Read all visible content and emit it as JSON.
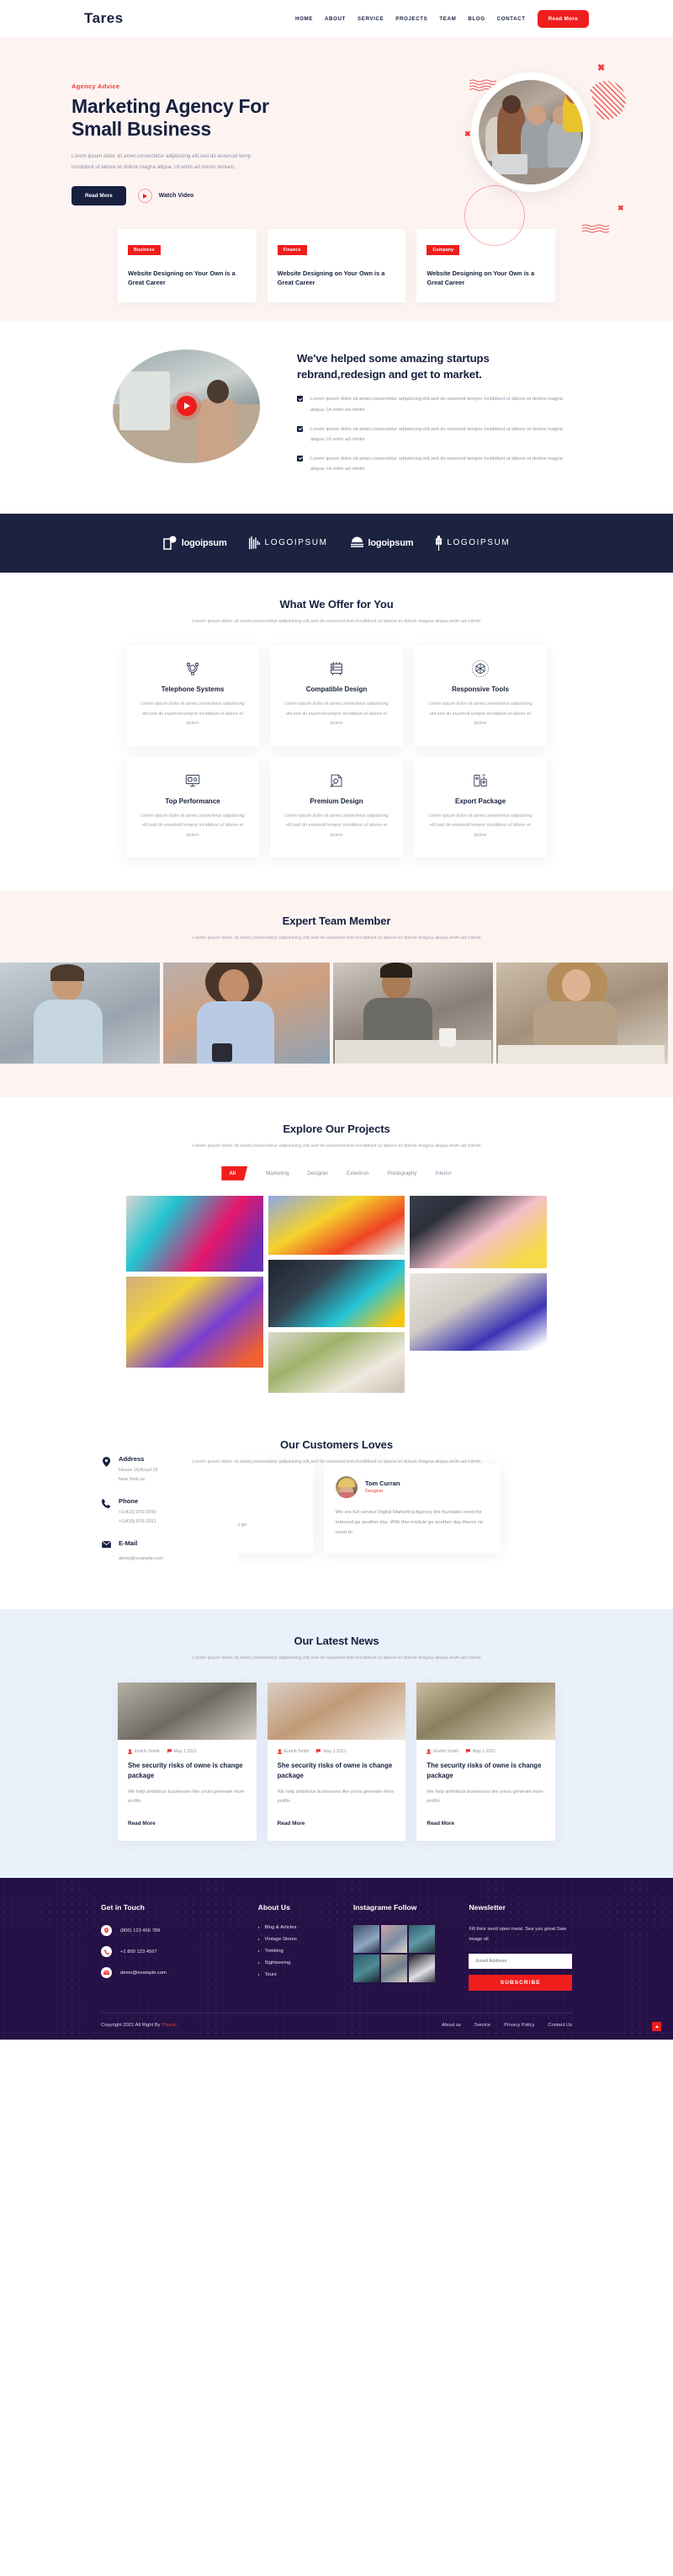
{
  "header": {
    "logo": "Tares",
    "nav": [
      {
        "label": "HOME"
      },
      {
        "label": "ABOUT"
      },
      {
        "label": "SERVICE"
      },
      {
        "label": "PROJECTS"
      },
      {
        "label": "TEAM"
      },
      {
        "label": "BLOG"
      },
      {
        "label": "CONTACT"
      }
    ],
    "cta": "Read More"
  },
  "hero": {
    "eyebrow": "Agency Advice",
    "title_line1": "Marketing Agency For",
    "title_line2": "Small Business",
    "paragraph": "Lorem ipsum dolor sit amet,consectetur adipisicing elit,sed do eiusmod temp incididunt ut labore et dolore magna aliqua. Ut enim ad minim veniam,",
    "primary_button": "Read More",
    "watch_label": "Watch Video",
    "accent_color": "#f01d1d",
    "dark_color": "#17203f",
    "bg_color": "#fdf4f2"
  },
  "top_cards": [
    {
      "tag": "Business",
      "title": "Website Designing on Your Own is a Great Career"
    },
    {
      "tag": "Finance",
      "title": "Website Designing on Your Own is a Great Career"
    },
    {
      "tag": "Company",
      "title": "Website Designing on Your Own is a Great Career"
    }
  ],
  "about": {
    "heading": "We've helped some amazing startups rebrand,redesign and get to market.",
    "checklist": [
      "Lorem ipsum dolor sit amet,consectetur adipisicing elit,sed do eiusmod tempor incididunt ut labore et dolore magna aliqua. Ut enim ad minim",
      "Lorem ipsum dolor sit amet,consectetur adipisicing elit,sed do eiusmod tempor incididunt ut labore et dolore magna aliqua. Ut enim ad minim",
      "Lorem ipsum dolor sit amet,consectetur adipisicing elit,sed do eiusmod tempor incididunt ut labore et dolore magna aliqua. Ut enim ad minim"
    ]
  },
  "logos": [
    {
      "name": "logoipsum",
      "style": "bold"
    },
    {
      "name": "LOGOIPSUM",
      "style": "spaced"
    },
    {
      "name": "logoipsum",
      "style": "bold"
    },
    {
      "name": "LOGOIPSUM",
      "style": "spaced"
    }
  ],
  "offer": {
    "title": "What We Offer for You",
    "subtitle": "Lorem ipsum dolor sit amet,consectetur adipisicing elit,sed do eiusmod tem incididunt ut labore et dolore magna aliqua.enim ad minim",
    "cards": [
      {
        "icon": "pen-tool-icon",
        "title": "Telephone Systems",
        "text": "Lorem ipsum dolor sit amet,consectetur adipisicing elit,sed do eiusmod tempor incididunt ut labore et dolore"
      },
      {
        "icon": "server-rack-icon",
        "title": "Compatible Design",
        "text": "Lorem ipsum dolor sit amet,consectetur adipisicing elit,sed do eiusmod tempor incididunt ut labore et dolore"
      },
      {
        "icon": "network-cube-icon",
        "title": "Responsive Tools",
        "text": "Lorem ipsum dolor sit amet,consectetur adipisicing elit,sed do eiusmod tempor incididunt ut labore et dolore"
      },
      {
        "icon": "monitor-icon",
        "title": "Top Performance",
        "text": "Lorem ipsum dolor sit amet,consectetur adipisicing elit,sed do eiusmod tempor incididunt ut labore et dolore"
      },
      {
        "icon": "design-document-icon",
        "title": "Premium Design",
        "text": "Lorem ipsum dolor sit amet,consectetur adipisicing elit,sed do eiusmod tempor incididunt ut labore et dolore"
      },
      {
        "icon": "package-export-icon",
        "title": "Export Package",
        "text": "Lorem ipsum dolor sit amet,consectetur adipisicing elit,sed do eiusmod tempor incididunt ut labore et dolore"
      }
    ]
  },
  "team": {
    "title": "Expert Team Member",
    "subtitle": "Lorem ipsum dolor sit amet,consectetur adipisicing elit,sed do eiusmod tem incididunt ut labore et dolore magna aliqua.enim ad minim"
  },
  "projects": {
    "title": "Explore Our Projects",
    "subtitle": "Lorem ipsum dolor sit amet,consectetur adipisicing elit,sed do eiusmod tem incididunt ut labore et dolore magna aliqua.enim ad minim",
    "filters": [
      {
        "label": "All",
        "active": true
      },
      {
        "label": "Marketing",
        "active": false
      },
      {
        "label": "Designer",
        "active": false
      },
      {
        "label": "Exteririon",
        "active": false
      },
      {
        "label": "Photography",
        "active": false
      },
      {
        "label": "Interior",
        "active": false
      }
    ]
  },
  "customers": {
    "title": "Our Customers Loves",
    "subtitle": "Lorem ipsum dolor sit amet,consectetur adipisicing elit,sed do eiusmod tem incididunt ut labore et dolore magna aliqua.enim ad minim",
    "contact": [
      {
        "icon": "location-pin-icon",
        "title": "Address",
        "lines": [
          "House 10,Road 15",
          "New York us"
        ]
      },
      {
        "icon": "phone-icon",
        "title": "Phone",
        "lines": [
          "+1(415) 876-3250",
          "+1(415) 876-3251"
        ]
      },
      {
        "icon": "envelope-icon",
        "title": "E-Mail",
        "lines": [
          "demo@example.com"
        ]
      }
    ],
    "testimonials": [
      {
        "name": "",
        "role": "",
        "text": "ng Agency the foundatio With this module go"
      },
      {
        "name": "Tom Curran",
        "role": "Designer",
        "text": "We are full service Digital Marketing Agency the foundatio need for inbound go another day. With this module go another day theres no need to."
      }
    ]
  },
  "news": {
    "title": "Our Latest News",
    "subtitle": "Lorem ipsum dolor sit amet,consectetur adipisicing elit,sed do eiusmod tem incididunt ut labore et dolore magna aliqua.enim ad minim",
    "posts": [
      {
        "author": "Endrih Smith",
        "date": "May 1,2021",
        "title": "She security risks of owne is change package",
        "excerpt": "We help ambitious businesses like yours generate more profits",
        "link": "Read More"
      },
      {
        "author": "Endrih Smith",
        "date": "May 1,2021",
        "title": "She security risks of owne is change package",
        "excerpt": "We help ambitious businesses like yours generate more profits",
        "link": "Read More"
      },
      {
        "author": "Endrih Smith",
        "date": "May 1,2021",
        "title": "The security risks of owne is change package",
        "excerpt": "We help ambitious businesses like yours generate more profits",
        "link": "Read More"
      }
    ]
  },
  "footer": {
    "get_in_touch": {
      "title": "Get in Touch",
      "items": [
        {
          "icon": "location-pin-icon",
          "text": "(800) 123 456 789"
        },
        {
          "icon": "phone-icon",
          "text": "+1 800 123 4567"
        },
        {
          "icon": "envelope-icon",
          "text": "demo@example.com"
        }
      ]
    },
    "about_us": {
      "title": "About Us",
      "links": [
        "Blog & Articles",
        "Vintage Stores",
        "Trekking",
        "Sightseeing",
        "Tours"
      ]
    },
    "instagram": {
      "title": "Instagrame Follow"
    },
    "newsletter": {
      "title": "Newsletter",
      "text": "Fill their seed open meat. Sea you great Saw image stl",
      "placeholder": "Email Address",
      "button": "SUBSCRIBE"
    },
    "copyright_prefix": "Copyright 2021 All Right By ",
    "copyright_brand": "Thucoi",
    "bottom_links": [
      "About us",
      "Service",
      "Privacy Policy",
      "Contact Us"
    ]
  }
}
